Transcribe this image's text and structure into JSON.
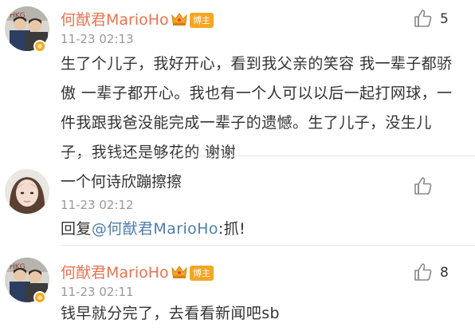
{
  "comments": [
    {
      "name": "何猷君MarioHo",
      "badge": "博主",
      "time": "11-23 02:13",
      "likes": "5",
      "text": "生了个儿子，我好开心，看到我父亲的笑容 我一辈子都骄傲 一辈子都开心。我也有一个人可以以后一起打网球，一件我跟我爸没能完成一辈子的遗憾。生了儿子，没生儿子，我钱还是够花的 谢谢"
    },
    {
      "name": "一个何诗欣蹦擦擦",
      "time": "11-23 02:12",
      "reply_prefix": "回复",
      "mention": "@何猷君MarioHo",
      "reply_text": ":抓!"
    },
    {
      "name": "何猷君MarioHo",
      "badge": "博主",
      "time": "11-23 02:11",
      "likes": "8",
      "text": "钱早就分完了，去看看新闻吧sb"
    }
  ],
  "colors": {
    "vip_name": "#eb7350",
    "mention": "#507daf",
    "badge_bg": "#f5a623",
    "timestamp": "#999999",
    "text": "#333333"
  },
  "icons": [
    "thumbs-up-icon",
    "crown-icon"
  ]
}
